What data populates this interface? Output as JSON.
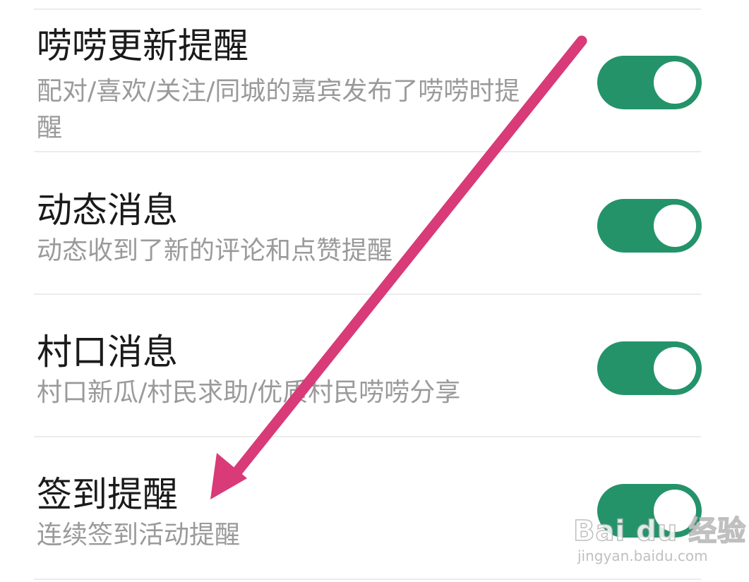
{
  "settings": {
    "items": [
      {
        "title": "唠唠更新提醒",
        "description": "配对/喜欢/关注/同城的嘉宾发布了唠唠时提醒",
        "enabled": true
      },
      {
        "title": "动态消息",
        "description": "动态收到了新的评论和点赞提醒",
        "enabled": true
      },
      {
        "title": "村口消息",
        "description": "村口新瓜/村民求助/优质村民唠唠分享",
        "enabled": true
      },
      {
        "title": "签到提醒",
        "description": "连续签到活动提醒",
        "enabled": true
      }
    ]
  },
  "annotation": {
    "arrow_color": "#d93a78"
  },
  "colors": {
    "toggle_on": "#24936a",
    "title_text": "#1a1a1a",
    "description_text": "#9a9a9a",
    "divider": "#ececec"
  },
  "watermark": {
    "logo_text": "Bai du 经验",
    "url_text": "jingyan.baidu.com"
  }
}
